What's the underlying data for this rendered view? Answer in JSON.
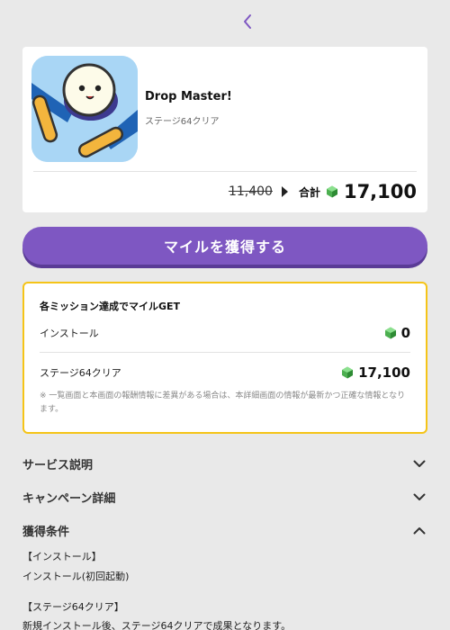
{
  "header": {
    "back_icon": "chevron-left-icon"
  },
  "app": {
    "name": "Drop Master!",
    "subtitle": "ステージ64クリア",
    "icon": "pinball-app-icon"
  },
  "price": {
    "old": "11,400",
    "total_label": "合計",
    "total": "17,100",
    "gem_icon": "green-gem-icon"
  },
  "cta": {
    "label": "マイルを獲得する"
  },
  "mission": {
    "title": "各ミッション達成でマイルGET",
    "rows": [
      {
        "label": "インストール",
        "value": "0"
      },
      {
        "label": "ステージ64クリア",
        "value": "17,100"
      }
    ],
    "note": "※ 一覧画面と本画面の報酬情報に差異がある場合は、本詳細画面の情報が最新かつ正確な情報となります。"
  },
  "accordions": [
    {
      "label": "サービス説明",
      "state": "collapsed"
    },
    {
      "label": "キャンペーン詳細",
      "state": "collapsed"
    },
    {
      "label": "獲得条件",
      "state": "expanded"
    }
  ],
  "conditions": {
    "h1": "【インストール】",
    "t1": "インストール(初回起動)",
    "h2": "【ステージ64クリア】",
    "t2": "新規インストール後、ステージ64クリアで成果となります。"
  },
  "colors": {
    "accent": "#7e57c2",
    "border": "#f5c418",
    "background": "#e9e9e9"
  }
}
